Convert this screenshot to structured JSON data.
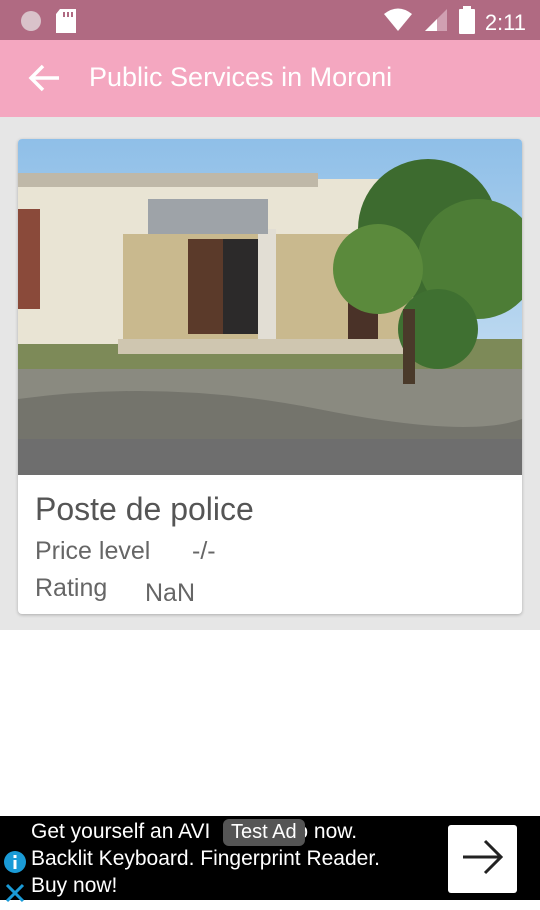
{
  "status_bar": {
    "time": "2:11"
  },
  "app_bar": {
    "title": "Public Services in Moroni"
  },
  "place": {
    "name": "Poste de police",
    "price_label": "Price level",
    "price_value": "-/-",
    "rating_label": "Rating",
    "rating_value": "NaN"
  },
  "ad": {
    "text_line1": "Get yourself an AVI",
    "text_line1_end": "o now.",
    "text_line2": "Backlit Keyboard. Fingerprint Reader.",
    "text_line3": "Buy now!",
    "badge": "Test Ad"
  },
  "colors": {
    "status_bar": "#b06a82",
    "app_bar": "#f4a7c0",
    "background": "#e6e6e6"
  }
}
